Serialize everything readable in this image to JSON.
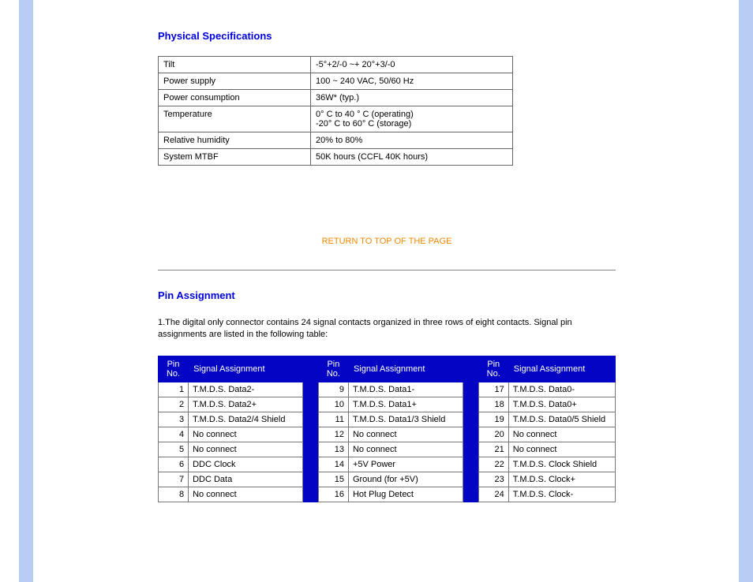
{
  "sections": {
    "phys_title": "Physical Specifications",
    "pin_title": "Pin Assignment"
  },
  "phys_specs": [
    {
      "label": "Tilt",
      "value": "-5°+2/-0 ~+ 20°+3/-0"
    },
    {
      "label": "Power supply",
      "value": "100 ~ 240 VAC, 50/60 Hz"
    },
    {
      "label": "Power consumption",
      "value": "36W* (typ.)"
    },
    {
      "label": "Temperature",
      "value": "0° C to 40 ° C (operating)\n-20° C to 60° C (storage)"
    },
    {
      "label": "Relative humidity",
      "value": "20% to 80%"
    },
    {
      "label": "System MTBF",
      "value": "50K hours (CCFL 40K hours)"
    }
  ],
  "return_link": "RETURN TO TOP OF THE PAGE",
  "pin_intro": "1.The digital only connector contains 24 signal contacts organized in three rows of eight contacts. Signal pin assignments are listed in the following table:",
  "pin_headers": {
    "no": "Pin No.",
    "sig": "Signal Assignment"
  },
  "pin_cols": [
    [
      {
        "no": "1",
        "sig": "T.M.D.S. Data2-"
      },
      {
        "no": "2",
        "sig": "T.M.D.S. Data2+"
      },
      {
        "no": "3",
        "sig": "T.M.D.S. Data2/4 Shield"
      },
      {
        "no": "4",
        "sig": "No connect"
      },
      {
        "no": "5",
        "sig": "No connect"
      },
      {
        "no": "6",
        "sig": "DDC Clock"
      },
      {
        "no": "7",
        "sig": "DDC Data"
      },
      {
        "no": "8",
        "sig": "No connect"
      }
    ],
    [
      {
        "no": "9",
        "sig": "T.M.D.S. Data1-"
      },
      {
        "no": "10",
        "sig": "T.M.D.S. Data1+"
      },
      {
        "no": "11",
        "sig": "T.M.D.S. Data1/3 Shield"
      },
      {
        "no": "12",
        "sig": "No connect"
      },
      {
        "no": "13",
        "sig": "No connect"
      },
      {
        "no": "14",
        "sig": "+5V Power"
      },
      {
        "no": "15",
        "sig": "Ground (for +5V)"
      },
      {
        "no": "16",
        "sig": "Hot Plug Detect"
      }
    ],
    [
      {
        "no": "17",
        "sig": "T.M.D.S. Data0-"
      },
      {
        "no": "18",
        "sig": "T.M.D.S. Data0+"
      },
      {
        "no": "19",
        "sig": "T.M.D.S. Data0/5 Shield"
      },
      {
        "no": "20",
        "sig": "No connect"
      },
      {
        "no": "21",
        "sig": "No connect"
      },
      {
        "no": "22",
        "sig": "T.M.D.S. Clock Shield"
      },
      {
        "no": "23",
        "sig": "T.M.D.S. Clock+"
      },
      {
        "no": "24",
        "sig": "T.M.D.S. Clock-"
      }
    ]
  ]
}
